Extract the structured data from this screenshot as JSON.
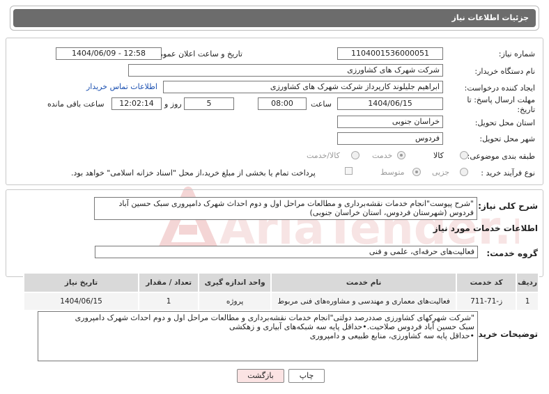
{
  "header": {
    "title": "جزئیات اطلاعات نیاز"
  },
  "form": {
    "need_number_label": "شماره نیاز:",
    "need_number": "1104001536000051",
    "announce_label": "تاریخ و ساعت اعلان عمومی:",
    "announce_value": "1404/06/09 - 12:58",
    "buyer_label": "نام دستگاه خریدار:",
    "buyer_value": "شرکت شهرک های کشاورزی",
    "creator_label": "ایجاد کننده درخواست:",
    "creator_value": "ابراهیم جلیلوند کارپرداز شرکت شهرک های کشاورزی",
    "contact_link": "اطلاعات تماس خریدار",
    "deadline_label": "مهلت ارسال پاسخ: تا تاریخ:",
    "deadline_date": "1404/06/15",
    "time_label": "ساعت",
    "deadline_time": "08:00",
    "days_value": "5",
    "days_label": "روز و",
    "remaining_time": "12:02:14",
    "remaining_label": "ساعت باقی مانده",
    "province_label": "استان محل تحویل:",
    "province_value": "خراسان جنوبی",
    "city_label": "شهر محل تحویل:",
    "city_value": "فردوس",
    "category_label": "طبقه بندی موضوعی:",
    "category_options": [
      "کالا",
      "خدمت",
      "کالا/خدمت"
    ],
    "category_selected": "خدمت",
    "process_label": "نوع فرآیند خرید :",
    "process_options": [
      "جزیی",
      "متوسط"
    ],
    "process_selected": "متوسط",
    "payment_note": "پرداخت تمام یا بخشی از مبلغ خرید،از محل \"اسناد خزانه اسلامی\" خواهد بود."
  },
  "summary": {
    "label": "شرح کلی نیاز:",
    "text": "\"شرح پیوست\"انجام خدمات نقشه‌برداری و مطالعات مراحل اول و دوم احداث شهرک دامپروری سبک حسین آباد فردوس (شهرستان فردوس، استان خراسان جنوبی)"
  },
  "services": {
    "section_title": "اطلاعات خدمات مورد نیاز",
    "group_label": "گروه خدمت:",
    "group_value": "فعالیت‌های حرفه‌ای، علمی و فنی",
    "columns": [
      "ردیف",
      "کد خدمت",
      "نام خدمت",
      "واحد اندازه گیری",
      "تعداد / مقدار",
      "تاریخ نیاز"
    ],
    "rows": [
      {
        "row": "1",
        "code": "ز-71-711",
        "name": "فعالیت‌های معماری و مهندسی و مشاوره‌های فنی مربوط",
        "unit": "پروژه",
        "qty": "1",
        "date": "1404/06/15"
      }
    ]
  },
  "buyer_notes": {
    "label": "توضیحات خریدار:",
    "lines": [
      "\"شرکت شهرکهای کشاورزی صددرصد دولتی\"انجام خدمات نقشه‌برداری و مطالعات مراحل اول و دوم احداث شهرک دامپروری",
      "سبک حسین آباد فردوس صلاحیت.•حداقل پایه سه شبکه‌های آبیاری و زهکشی",
      "•حداقل پایه سه کشاورزی، منابع طبیعی و دامپروری"
    ]
  },
  "buttons": {
    "print": "چاپ",
    "back": "بازگشت"
  },
  "watermark": {
    "text": "AriaTender.neT"
  },
  "colors": {
    "header_bg": "#6c6c6c",
    "link": "#1a4fb0",
    "back_btn_bg": "#fbe3e3",
    "watermark": "#e7b8b8"
  }
}
